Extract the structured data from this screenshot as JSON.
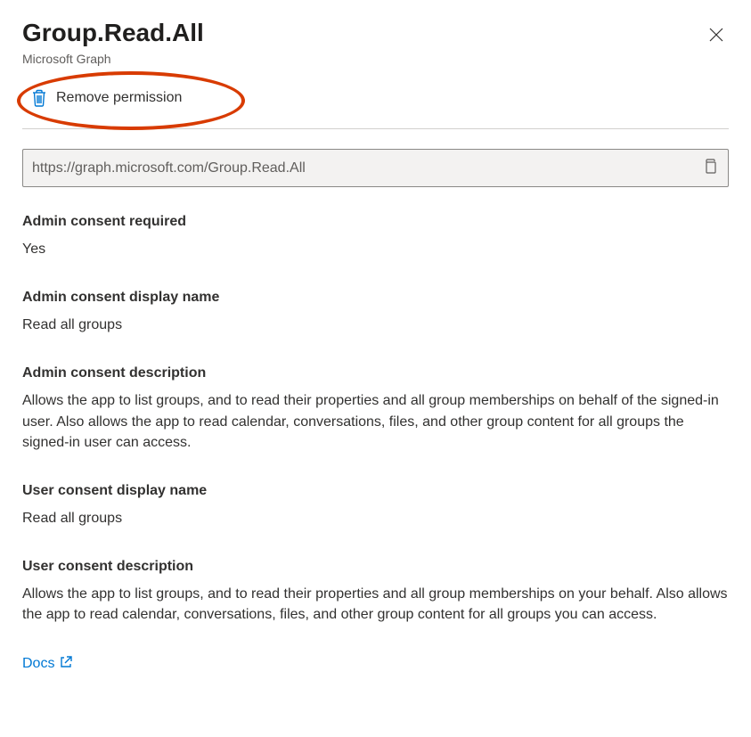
{
  "header": {
    "title": "Group.Read.All",
    "subtitle": "Microsoft Graph"
  },
  "toolbar": {
    "remove_permission_label": "Remove permission"
  },
  "url": {
    "value": "https://graph.microsoft.com/Group.Read.All"
  },
  "sections": {
    "admin_consent_required": {
      "label": "Admin consent required",
      "value": "Yes"
    },
    "admin_consent_display_name": {
      "label": "Admin consent display name",
      "value": "Read all groups"
    },
    "admin_consent_description": {
      "label": "Admin consent description",
      "value": "Allows the app to list groups, and to read their properties and all group memberships on behalf of the signed-in user. Also allows the app to read calendar, conversations, files, and other group content for all groups the signed-in user can access."
    },
    "user_consent_display_name": {
      "label": "User consent display name",
      "value": "Read all groups"
    },
    "user_consent_description": {
      "label": "User consent description",
      "value": "Allows the app to list groups, and to read their properties and all group memberships on your behalf. Also allows the app to read calendar, conversations, files, and other group content for all groups you can access."
    }
  },
  "docs": {
    "label": "Docs"
  }
}
